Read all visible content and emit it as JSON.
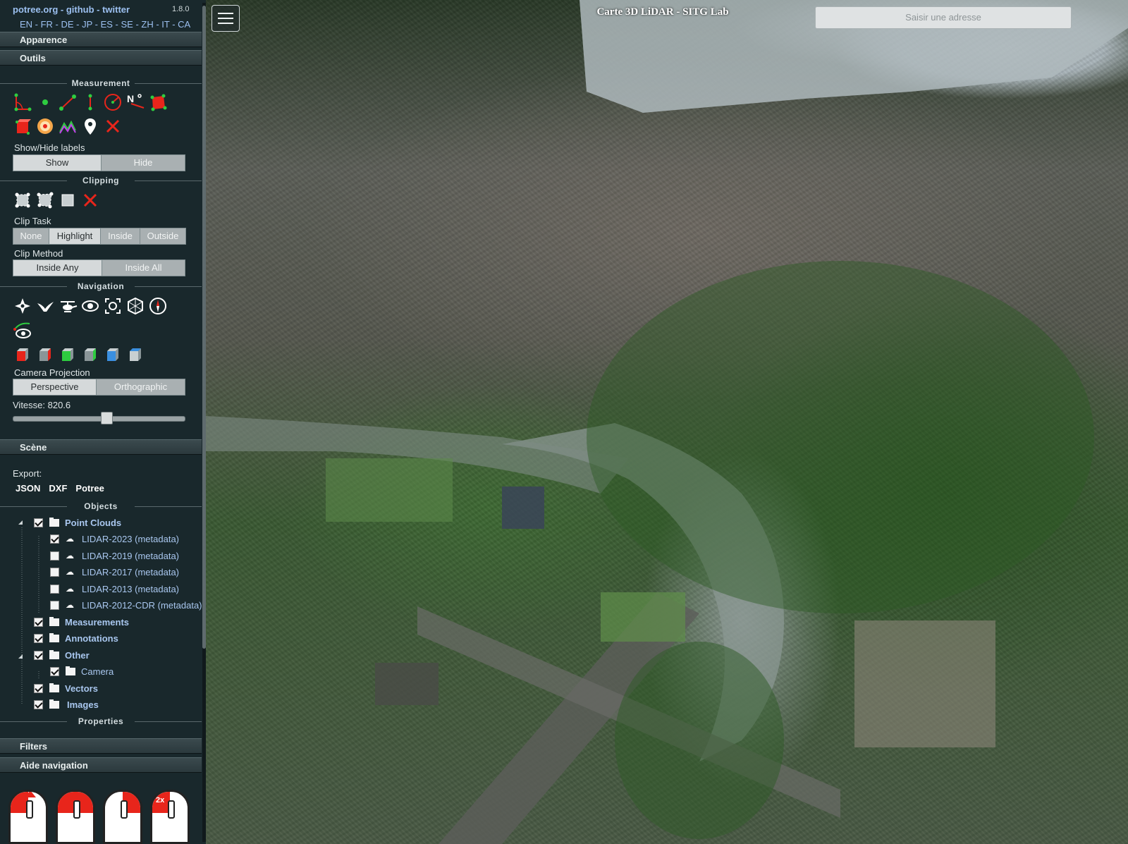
{
  "header": {
    "links": "potree.org - github - twitter",
    "version": "1.8.0",
    "languages": "EN - FR - DE - JP - ES - SE - ZH - IT - CA"
  },
  "accordions": {
    "apparence": "Apparence",
    "outils": "Outils",
    "scene": "Scène",
    "filters": "Filters",
    "aide": "Aide navigation"
  },
  "measurement": {
    "title": "Measurement",
    "tools": [
      "angle-icon",
      "point-icon",
      "distance-icon",
      "height-icon",
      "circle-icon",
      "azimuth-icon",
      "area-icon",
      "volume-icon",
      "sphere-volume-icon",
      "profile-icon",
      "annotation-icon",
      "remove-all-icon"
    ],
    "labels_title": "Show/Hide labels",
    "labels_buttons": [
      "Show",
      "Hide"
    ]
  },
  "clipping": {
    "title": "Clipping",
    "clip_task_label": "Clip Task",
    "clip_task_options": [
      "None",
      "Highlight",
      "Inside",
      "Outside"
    ],
    "clip_method_label": "Clip Method",
    "clip_method_options": [
      "Inside Any",
      "Inside All"
    ]
  },
  "navigation": {
    "title": "Navigation",
    "camera_projection_label": "Camera Projection",
    "camera_projection_options": [
      "Perspective",
      "Orthographic"
    ],
    "speed_label": "Vitesse: 820.6",
    "speed_fraction": 0.55
  },
  "scene": {
    "export_label": "Export:",
    "export_formats": [
      "JSON",
      "DXF",
      "Potree"
    ],
    "objects_title": "Objects",
    "properties_title": "Properties",
    "tree": {
      "point_clouds": "Point Clouds",
      "lidar_2023": "LIDAR-2023 (metadata)",
      "lidar_2019": "LIDAR-2019 (metadata)",
      "lidar_2017": "LIDAR-2017 (metadata)",
      "lidar_2013": "LIDAR-2013 (metadata)",
      "lidar_2012": "LIDAR-2012-CDR (metadata)",
      "measurements": "Measurements",
      "annotations": "Annotations",
      "other": "Other",
      "camera": "Camera",
      "vectors": "Vectors",
      "images": "Images"
    }
  },
  "viewer": {
    "title": "Carte 3D LiDAR - SITG Lab",
    "address_placeholder": "Saisir une adresse",
    "mouse_double_label": "2x"
  },
  "colors": {
    "sidebar_bg": "#19282c",
    "link_blue": "#9cc0f0",
    "accent_red": "#e8251b",
    "accent_green": "#2ecc40"
  }
}
